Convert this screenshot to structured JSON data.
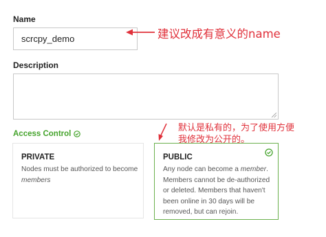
{
  "form": {
    "name_label": "Name",
    "name_value": "scrcpy_demo",
    "description_label": "Description",
    "description_value": "",
    "access_control_label": "Access Control"
  },
  "access_options": [
    {
      "title": "PRIVATE",
      "desc_pre": "Nodes must be authorized to become ",
      "desc_em": "members",
      "desc_post": "",
      "selected": false
    },
    {
      "title": "PUBLIC",
      "desc_pre": "Any node can become a ",
      "desc_em": "member",
      "desc_post": ". Members cannot be de-authorized or deleted. Members that haven't been online in 30 days will be removed, but can rejoin.",
      "selected": true
    }
  ],
  "annotations": {
    "name_note": "建议改成有意义的name",
    "access_note_line1": "默认是私有的，为了使用方便",
    "access_note_line2": "我修改为公开的。"
  },
  "colors": {
    "accent_green": "#44a32b",
    "annotation_red": "#e0303a"
  },
  "icons": {
    "access_control": "check-circle-icon",
    "public_selected": "check-circle-icon"
  }
}
